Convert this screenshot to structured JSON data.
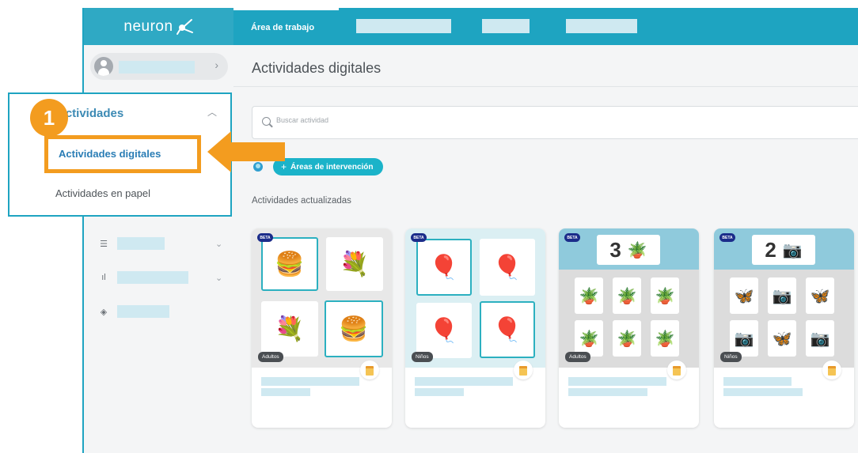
{
  "app": {
    "logo_text": "neuron"
  },
  "topnav": {
    "active_tab": "Área de trabajo"
  },
  "sidebar": {
    "menu": {
      "heading": "Actividades",
      "items": [
        {
          "label": "Actividades digitales",
          "active": true
        },
        {
          "label": "Actividades en papel",
          "active": false
        }
      ]
    }
  },
  "tutorial": {
    "step_number": "1"
  },
  "main": {
    "page_title": "Actividades digitales",
    "search": {
      "placeholder": "Buscar actividad"
    },
    "areas_button": {
      "plus": "+",
      "label": "Áreas de intervención"
    },
    "section_title": "Actividades actualizadas",
    "cards": [
      {
        "badge": "BETA",
        "age": "Adultos",
        "theme": "pairs",
        "tiles": [
          "🍔",
          "💐",
          "💐",
          "🍔"
        ]
      },
      {
        "badge": "BETA",
        "age": "Niños",
        "theme": "pairs",
        "tiles": [
          "🎈",
          "🎈",
          "🎈",
          "🎈"
        ]
      },
      {
        "badge": "BETA",
        "age": "Adultos",
        "theme": "count",
        "number": "3",
        "icon": "🪴",
        "tiles": [
          "🪴",
          "🪴",
          "🪴",
          "🪴",
          "🪴",
          "🪴"
        ]
      },
      {
        "badge": "BETA",
        "age": "Niños",
        "theme": "count",
        "number": "2",
        "icon": "📷",
        "tiles": [
          "🦋",
          "📷",
          "🦋",
          "📷",
          "🦋",
          "📷"
        ]
      }
    ]
  },
  "colors": {
    "brand": "#1ea4c1",
    "highlight": "#f39c1f",
    "active_text": "#2a7db5"
  }
}
